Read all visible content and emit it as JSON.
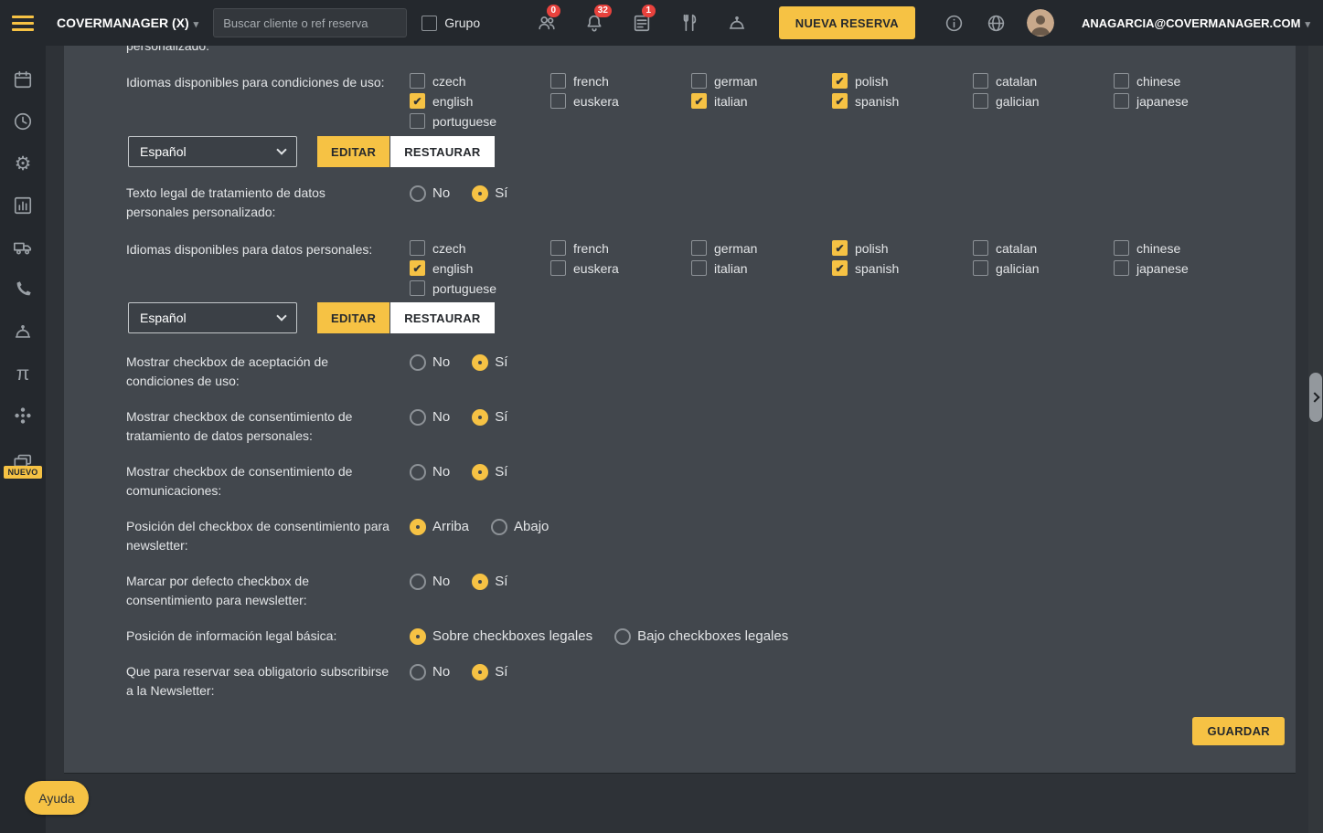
{
  "topbar": {
    "brand": "COVERMANAGER (X)",
    "search_placeholder": "Buscar cliente o ref reserva",
    "grupo_label": "Grupo",
    "badge_people": "0",
    "badge_notifications": "32",
    "badge_lists": "1",
    "new_reservation_label": "NUEVA RESERVA",
    "user_email": "ANAGARCIA@COVERMANAGER.COM"
  },
  "sidebar": {
    "nuevo_badge": "NUEVO",
    "icons": [
      "calendar-icon",
      "clock-icon",
      "gear-icon",
      "chart-icon",
      "truck-icon",
      "phone-icon",
      "service-bell-icon",
      "tables-icon",
      "integrations-icon",
      "ticket-icon"
    ]
  },
  "colors": {
    "accent": "#f6c244",
    "badge_red": "#e8423d",
    "card_bg": "#42474d",
    "topbar_bg": "#24282d"
  },
  "form": {
    "clipped_label": "personalizado:",
    "langs_condiciones": {
      "label": "Idiomas disponibles para condiciones de uso:",
      "options": [
        {
          "label": "czech",
          "checked": false
        },
        {
          "label": "french",
          "checked": false
        },
        {
          "label": "german",
          "checked": false
        },
        {
          "label": "polish",
          "checked": true
        },
        {
          "label": "catalan",
          "checked": false
        },
        {
          "label": "chinese",
          "checked": false
        },
        {
          "label": "english",
          "checked": true
        },
        {
          "label": "euskera",
          "checked": false
        },
        {
          "label": "italian",
          "checked": true
        },
        {
          "label": "spanish",
          "checked": true
        },
        {
          "label": "galician",
          "checked": false
        },
        {
          "label": "japanese",
          "checked": false
        },
        {
          "label": "portuguese",
          "checked": false
        }
      ]
    },
    "select_condiciones": {
      "value": "Español",
      "editar": "EDITAR",
      "restaurar": "RESTAURAR"
    },
    "texto_legal": {
      "label": "Texto legal de tratamiento de datos personales personalizado:",
      "options": [
        {
          "label": "No",
          "selected": false
        },
        {
          "label": "Sí",
          "selected": true
        }
      ]
    },
    "langs_datos": {
      "label": "Idiomas disponibles para datos personales:",
      "options": [
        {
          "label": "czech",
          "checked": false
        },
        {
          "label": "french",
          "checked": false
        },
        {
          "label": "german",
          "checked": false
        },
        {
          "label": "polish",
          "checked": true
        },
        {
          "label": "catalan",
          "checked": false
        },
        {
          "label": "chinese",
          "checked": false
        },
        {
          "label": "english",
          "checked": true
        },
        {
          "label": "euskera",
          "checked": false
        },
        {
          "label": "italian",
          "checked": false
        },
        {
          "label": "spanish",
          "checked": true
        },
        {
          "label": "galician",
          "checked": false
        },
        {
          "label": "japanese",
          "checked": false
        },
        {
          "label": "portuguese",
          "checked": false
        }
      ]
    },
    "select_datos": {
      "value": "Español",
      "editar": "EDITAR",
      "restaurar": "RESTAURAR"
    },
    "radio_rows": [
      {
        "label": "Mostrar checkbox de aceptación de condiciones de uso:",
        "options": [
          {
            "label": "No",
            "selected": false
          },
          {
            "label": "Sí",
            "selected": true
          }
        ]
      },
      {
        "label": "Mostrar checkbox de consentimiento de tratamiento de datos personales:",
        "options": [
          {
            "label": "No",
            "selected": false
          },
          {
            "label": "Sí",
            "selected": true
          }
        ]
      },
      {
        "label": "Mostrar checkbox de consentimiento de comunicaciones:",
        "options": [
          {
            "label": "No",
            "selected": false
          },
          {
            "label": "Sí",
            "selected": true
          }
        ]
      },
      {
        "label": "Posición del checkbox de consentimiento para newsletter:",
        "options": [
          {
            "label": "Arriba",
            "selected": true
          },
          {
            "label": "Abajo",
            "selected": false
          }
        ]
      },
      {
        "label": "Marcar por defecto checkbox de consentimiento para newsletter:",
        "options": [
          {
            "label": "No",
            "selected": false
          },
          {
            "label": "Sí",
            "selected": true
          }
        ]
      },
      {
        "label": "Posición de información legal básica:",
        "options": [
          {
            "label": "Sobre checkboxes legales",
            "selected": true
          },
          {
            "label": "Bajo checkboxes legales",
            "selected": false
          }
        ]
      },
      {
        "label": "Que para reservar sea obligatorio subscribirse a la Newsletter:",
        "options": [
          {
            "label": "No",
            "selected": false
          },
          {
            "label": "Sí",
            "selected": true
          }
        ]
      }
    ],
    "guardar_label": "GUARDAR"
  },
  "footer": {
    "help_label": "Ayuda"
  }
}
